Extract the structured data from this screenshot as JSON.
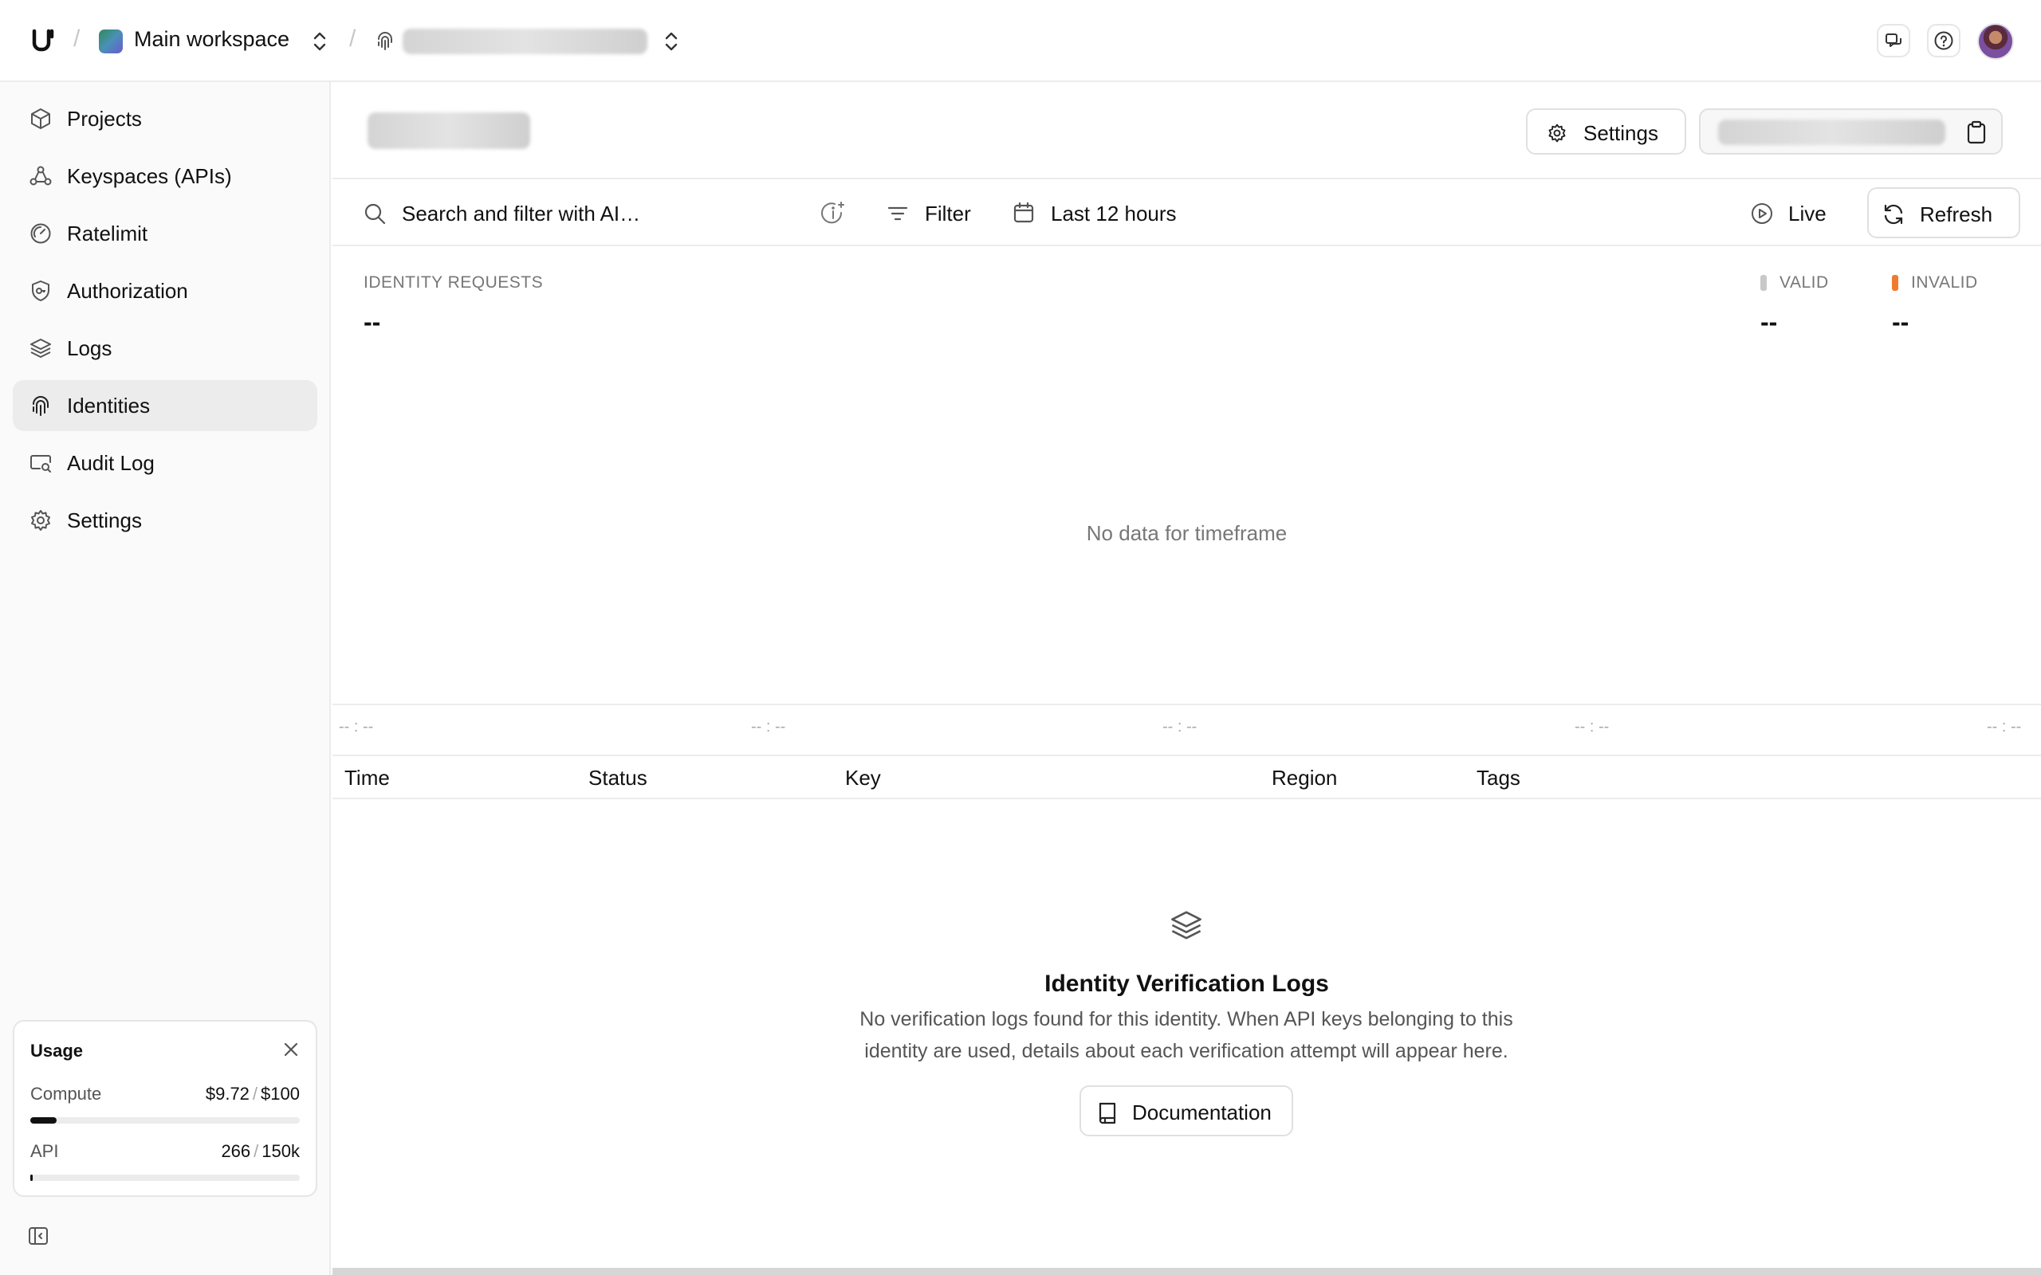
{
  "topbar": {
    "workspace_name": "Main workspace",
    "separator": "/"
  },
  "sidebar": {
    "items": [
      {
        "label": "Projects",
        "icon": "cube-icon"
      },
      {
        "label": "Keyspaces (APIs)",
        "icon": "nodes-icon"
      },
      {
        "label": "Ratelimit",
        "icon": "gauge-icon"
      },
      {
        "label": "Authorization",
        "icon": "shield-key-icon"
      },
      {
        "label": "Logs",
        "icon": "layers-icon"
      },
      {
        "label": "Identities",
        "icon": "fingerprint-icon",
        "active": true
      },
      {
        "label": "Audit Log",
        "icon": "monitor-search-icon"
      },
      {
        "label": "Settings",
        "icon": "gear-icon"
      }
    ],
    "usage": {
      "title": "Usage",
      "compute_label": "Compute",
      "compute_used": "$9.72",
      "compute_limit": "$100",
      "compute_fraction": 0.0972,
      "api_label": "API",
      "api_used": "266",
      "api_limit": "150k",
      "api_fraction": 0.0018,
      "slash": "/"
    }
  },
  "header": {
    "settings_label": "Settings"
  },
  "toolbar": {
    "search_placeholder": "Search and filter with AI…",
    "filter_label": "Filter",
    "timerange_label": "Last 12 hours",
    "live_label": "Live",
    "refresh_label": "Refresh"
  },
  "stats": {
    "requests_label": "IDENTITY REQUESTS",
    "requests_value": "--",
    "valid_label": "VALID",
    "valid_value": "--",
    "invalid_label": "INVALID",
    "invalid_value": "--",
    "valid_color": "#c8c8c8",
    "invalid_color": "#f07a2e"
  },
  "chart": {
    "empty_message": "No data for timeframe",
    "ticks": [
      "-- : --",
      "-- : --",
      "-- : --",
      "-- : --",
      "-- : --"
    ]
  },
  "table": {
    "columns": [
      "Time",
      "Status",
      "Key",
      "Region",
      "Tags"
    ]
  },
  "empty_state": {
    "title": "Identity Verification Logs",
    "description": "No verification logs found for this identity. When API keys belonging to this identity are used, details about each verification attempt will appear here.",
    "button_label": "Documentation"
  }
}
